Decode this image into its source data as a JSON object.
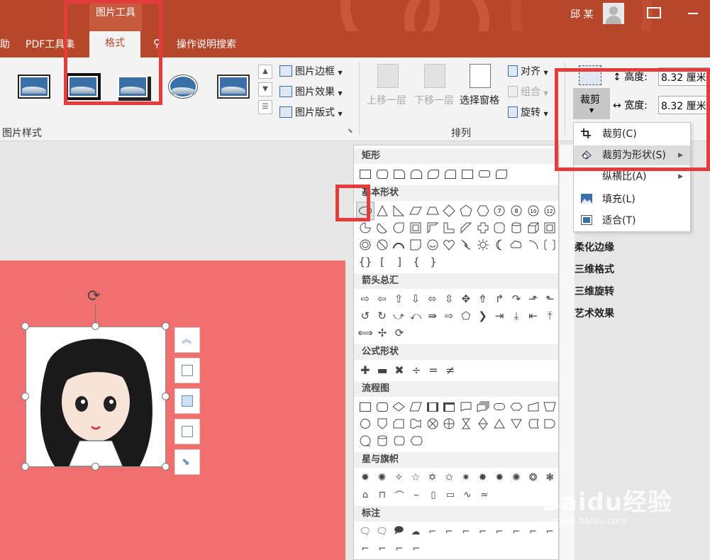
{
  "titlebar": {
    "context_label": "图片工具",
    "user_name": "邱 某"
  },
  "tabs": [
    {
      "label": "助"
    },
    {
      "label": "PDF工具集"
    },
    {
      "label": "格式"
    },
    {
      "label": "操作说明搜索"
    }
  ],
  "ribbon": {
    "picture_styles_label": "图片样式",
    "picture_border": "图片边框",
    "picture_effects": "图片效果",
    "picture_layout": "图片版式",
    "bring_forward": "上移一层",
    "send_backward": "下移一层",
    "selection_pane": "选择窗格",
    "align": "对齐",
    "group": "组合",
    "rotate": "旋转",
    "arrange_label": "排列",
    "crop": "裁剪",
    "height_label": "高度:",
    "height_value": "8.32 厘米",
    "width_label": "宽度:",
    "width_value": "8.32 厘米"
  },
  "crop_menu": [
    {
      "label": "裁剪(C)",
      "icon": "crop-icon"
    },
    {
      "label": "裁剪为形状(S)",
      "icon": "shape-icon",
      "submenu": true,
      "highlighted": true
    },
    {
      "label": "纵横比(A)",
      "submenu": true
    },
    {
      "label": "填充(L)",
      "icon": "fill-icon"
    },
    {
      "label": "适合(T)",
      "icon": "fit-icon"
    }
  ],
  "right_panel": [
    "柔化边缘",
    "三维格式",
    "三维旋转",
    "艺术效果"
  ],
  "gallery": {
    "sections": [
      {
        "title": "矩形"
      },
      {
        "title": "基本形状"
      },
      {
        "title": "箭头总汇"
      },
      {
        "title": "公式形状"
      },
      {
        "title": "流程图"
      },
      {
        "title": "星与旗帜"
      },
      {
        "title": "标注"
      }
    ]
  },
  "watermark": {
    "main": "Baidu经验",
    "sub": "jingyan.baidu.com"
  }
}
